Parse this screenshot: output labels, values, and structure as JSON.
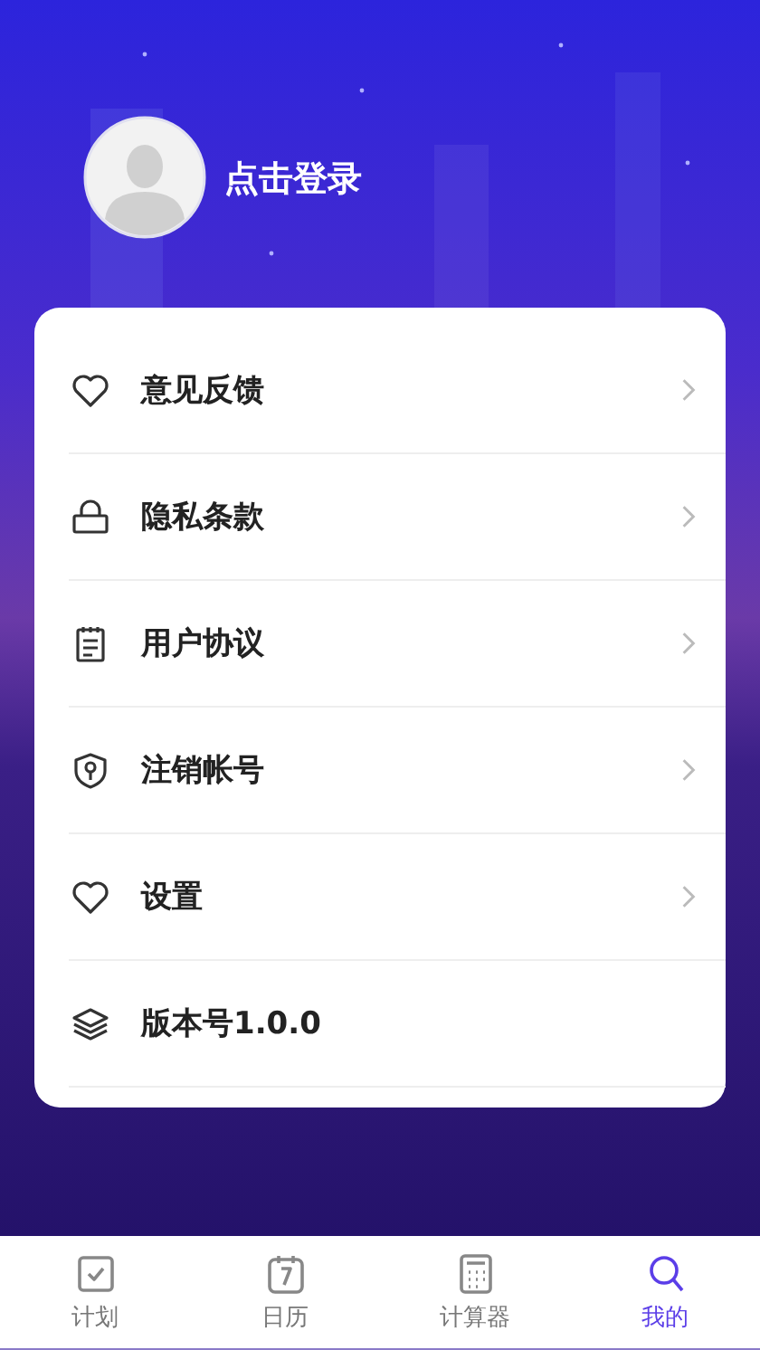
{
  "profile": {
    "login_label": "点击登录"
  },
  "menu": [
    {
      "label": "意见反馈",
      "chevron": true
    },
    {
      "label": "隐私条款",
      "chevron": true
    },
    {
      "label": "用户协议",
      "chevron": true
    },
    {
      "label": "注销帐号",
      "chevron": true
    },
    {
      "label": "设置",
      "chevron": true
    },
    {
      "label": "版本号1.0.0",
      "chevron": false
    }
  ],
  "tabs": [
    {
      "label": "计划",
      "selected": false
    },
    {
      "label": "日历",
      "selected": false
    },
    {
      "label": "计算器",
      "selected": false
    },
    {
      "label": "我的",
      "selected": true
    }
  ]
}
